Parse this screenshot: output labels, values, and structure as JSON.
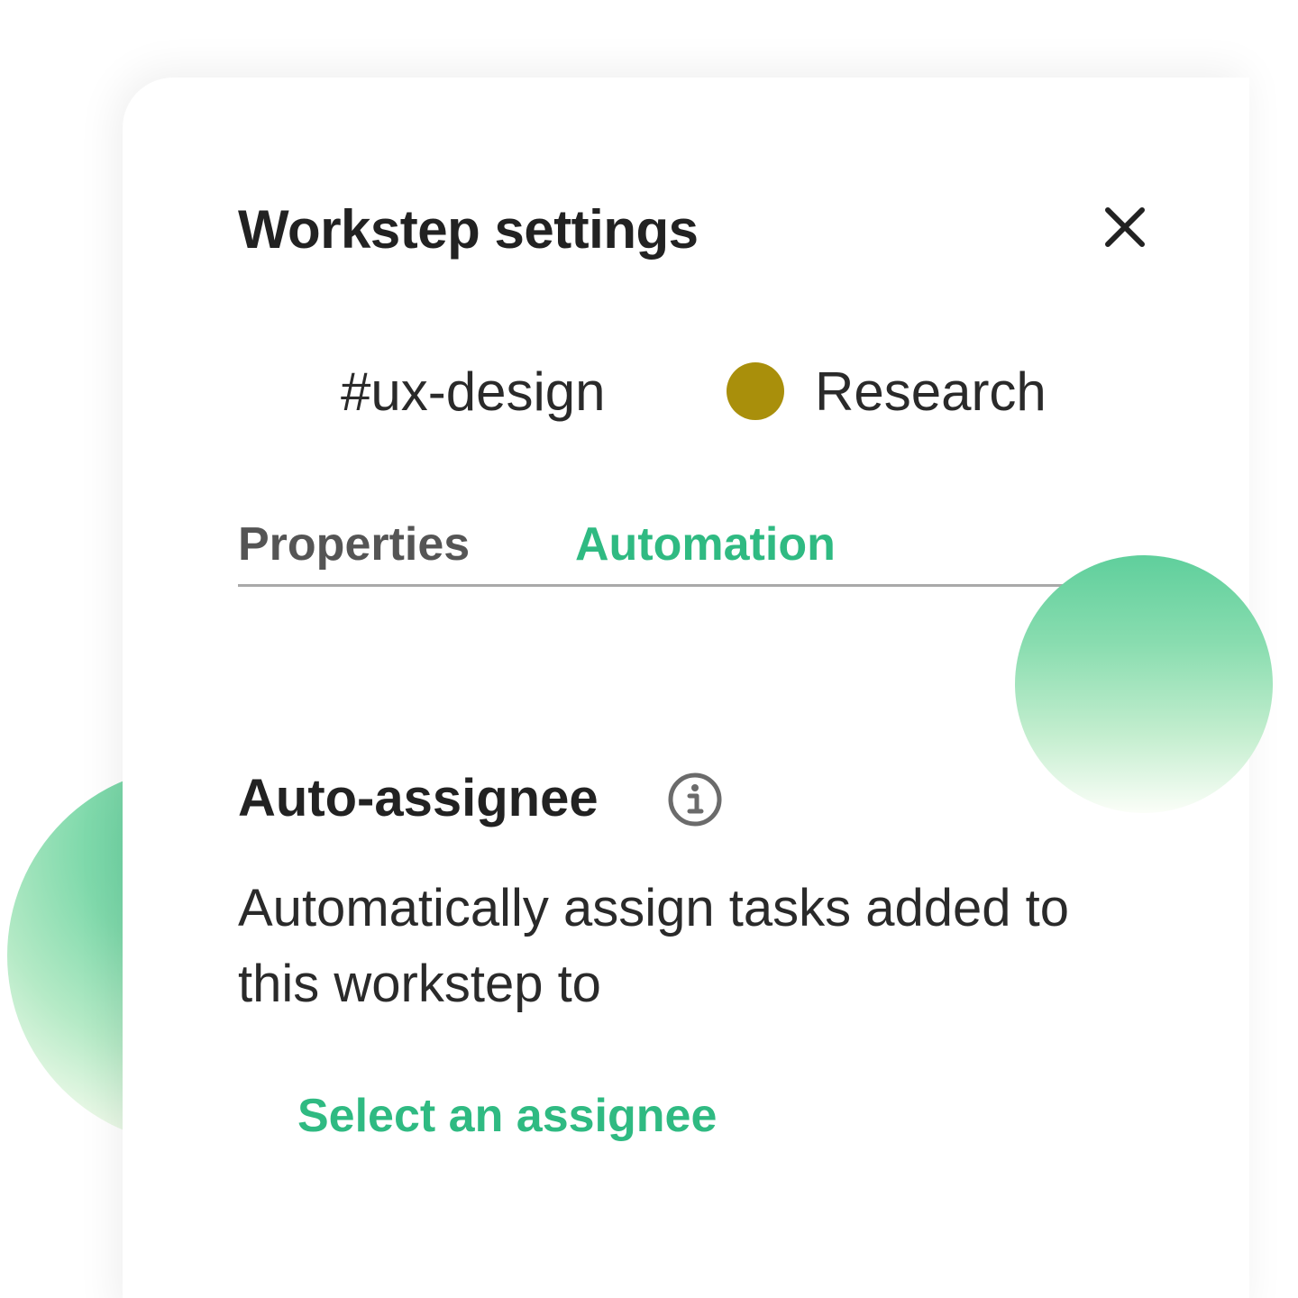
{
  "panel": {
    "title": "Workstep settings",
    "close_icon": "close-icon"
  },
  "workstep": {
    "channel": "#ux-design",
    "status_label": "Research",
    "status_color": "#a98f0b"
  },
  "tabs": [
    {
      "label": "Properties",
      "active": false
    },
    {
      "label": "Automation",
      "active": true
    }
  ],
  "auto_assignee": {
    "title": "Auto-assignee",
    "info_icon": "info-icon",
    "description": "Automatically assign tasks added to this workstep to",
    "action_label": "Select an assignee"
  },
  "colors": {
    "accent": "#2fba82",
    "text": "#222222",
    "muted_tab": "#555555",
    "divider": "#a9a9a9"
  }
}
